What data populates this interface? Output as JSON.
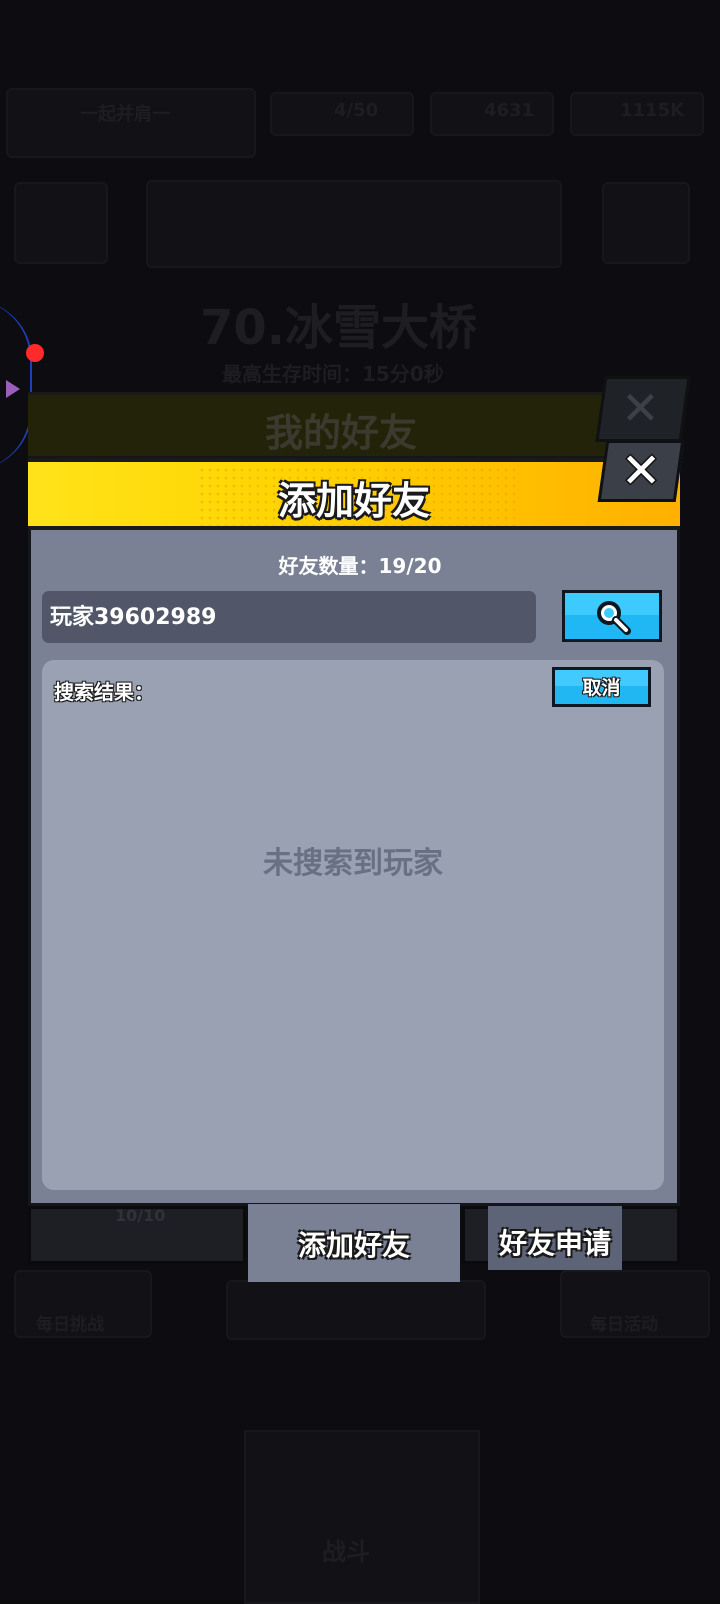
{
  "background": {
    "player_name": "一起并肩一",
    "stamina": "4/50",
    "gems": "4631",
    "coins": "1115K",
    "level_title": "70.冰雪大桥",
    "level_sub": "最高生存时间：15分0秒",
    "side_left_label": "每日挑战",
    "side_right_label": "每日活动",
    "center_label": "战斗"
  },
  "back_panel": {
    "title": "我的好友"
  },
  "dialog": {
    "title": "添加好友",
    "friend_count_label": "好友数量：19/20",
    "search_value": "玩家39602989",
    "results_label": "搜索结果：",
    "cancel_label": "取消",
    "empty_message": "未搜索到玩家"
  },
  "tabs": {
    "left_badge": "10/10",
    "add_friend": "添加好友",
    "friend_requests": "好友申请"
  },
  "colors": {
    "header_yellow": "#ffd400",
    "panel": "#7a8194",
    "results_bg": "#9aa1b3",
    "button_blue": "#1fb8f5"
  }
}
